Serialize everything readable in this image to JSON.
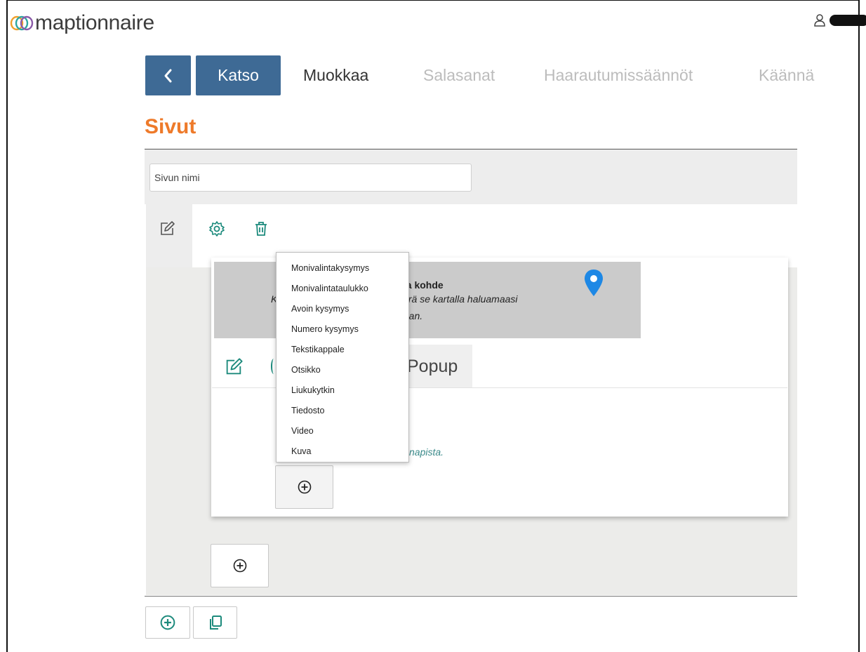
{
  "header": {
    "app_name": "maptionnaire",
    "user_icon": "person-icon"
  },
  "tabs": {
    "back_icon": "chevron-left-icon",
    "items": [
      {
        "label": "Katso",
        "active": true
      },
      {
        "label": "Muokkaa",
        "active": false
      },
      {
        "label": "Salasanat",
        "active": false
      },
      {
        "label": "Haarautumissäännöt",
        "active": false
      },
      {
        "label": "Käännä",
        "active": false
      }
    ]
  },
  "page": {
    "title": "Sivut",
    "name_placeholder": "Sivun nimi",
    "tools": [
      "edit-icon",
      "gear-icon",
      "trash-icon"
    ]
  },
  "card": {
    "map_heading": "va kohde",
    "map_text_1": "K",
    "map_text_2": "iirrä se kartalla haluamaasi",
    "map_text_3": "taan.",
    "popup_tab": "Popup",
    "hint": "napista."
  },
  "dropdown": {
    "items": [
      "Monivalintakysymys",
      "Monivalintataulukko",
      "Avoin kysymys",
      "Numero kysymys",
      "Tekstikappale",
      "Otsikko",
      "Liukukytkin",
      "Tiedosto",
      "Video",
      "Kuva"
    ]
  },
  "colors": {
    "accent": "#3e6a95",
    "title": "#ee7a2a",
    "icon": "#1c8a7c",
    "pin": "#1e88e5"
  }
}
